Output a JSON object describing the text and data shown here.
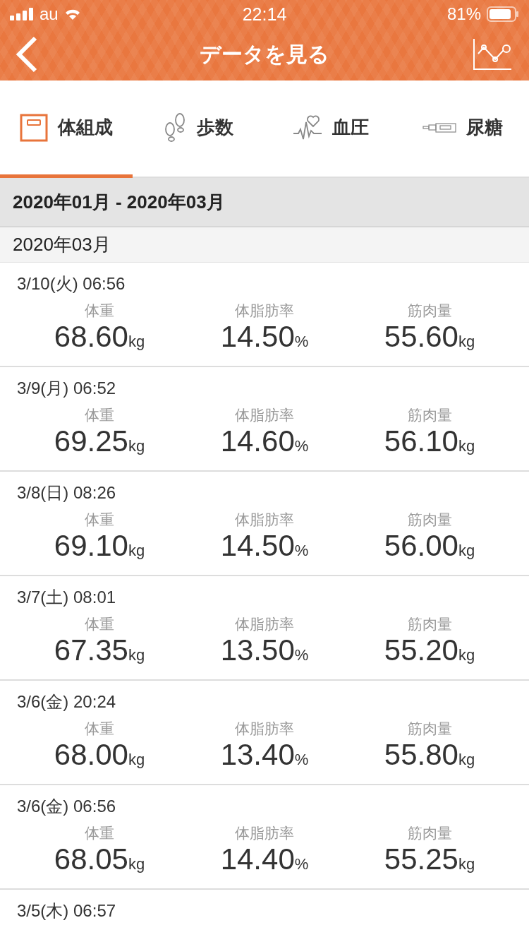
{
  "status_bar": {
    "carrier": "au",
    "time": "22:14",
    "battery": "81%"
  },
  "nav": {
    "title": "データを見る"
  },
  "tabs": [
    {
      "kind": "scale",
      "label": "体組成",
      "selected": true
    },
    {
      "kind": "steps",
      "label": "歩数",
      "selected": false
    },
    {
      "kind": "pressure",
      "label": "血圧",
      "selected": false
    },
    {
      "kind": "glucose",
      "label": "尿糖",
      "selected": false
    }
  ],
  "range": "2020年01月 - 2020年03月",
  "month": "2020年03月",
  "records": [
    {
      "date": "3/10(火) 06:56",
      "metrics": [
        {
          "label": "体重",
          "value": "68.60",
          "unit": "kg"
        },
        {
          "label": "体脂肪率",
          "value": "14.50",
          "unit": "%"
        },
        {
          "label": "筋肉量",
          "value": "55.60",
          "unit": "kg"
        }
      ]
    },
    {
      "date": "3/9(月) 06:52",
      "metrics": [
        {
          "label": "体重",
          "value": "69.25",
          "unit": "kg"
        },
        {
          "label": "体脂肪率",
          "value": "14.60",
          "unit": "%"
        },
        {
          "label": "筋肉量",
          "value": "56.10",
          "unit": "kg"
        }
      ]
    },
    {
      "date": "3/8(日) 08:26",
      "metrics": [
        {
          "label": "体重",
          "value": "69.10",
          "unit": "kg"
        },
        {
          "label": "体脂肪率",
          "value": "14.50",
          "unit": "%"
        },
        {
          "label": "筋肉量",
          "value": "56.00",
          "unit": "kg"
        }
      ]
    },
    {
      "date": "3/7(土) 08:01",
      "metrics": [
        {
          "label": "体重",
          "value": "67.35",
          "unit": "kg"
        },
        {
          "label": "体脂肪率",
          "value": "13.50",
          "unit": "%"
        },
        {
          "label": "筋肉量",
          "value": "55.20",
          "unit": "kg"
        }
      ]
    },
    {
      "date": "3/6(金) 20:24",
      "metrics": [
        {
          "label": "体重",
          "value": "68.00",
          "unit": "kg"
        },
        {
          "label": "体脂肪率",
          "value": "13.40",
          "unit": "%"
        },
        {
          "label": "筋肉量",
          "value": "55.80",
          "unit": "kg"
        }
      ]
    },
    {
      "date": "3/6(金) 06:56",
      "metrics": [
        {
          "label": "体重",
          "value": "68.05",
          "unit": "kg"
        },
        {
          "label": "体脂肪率",
          "value": "14.40",
          "unit": "%"
        },
        {
          "label": "筋肉量",
          "value": "55.25",
          "unit": "kg"
        }
      ]
    },
    {
      "date": "3/5(木) 06:57"
    }
  ]
}
